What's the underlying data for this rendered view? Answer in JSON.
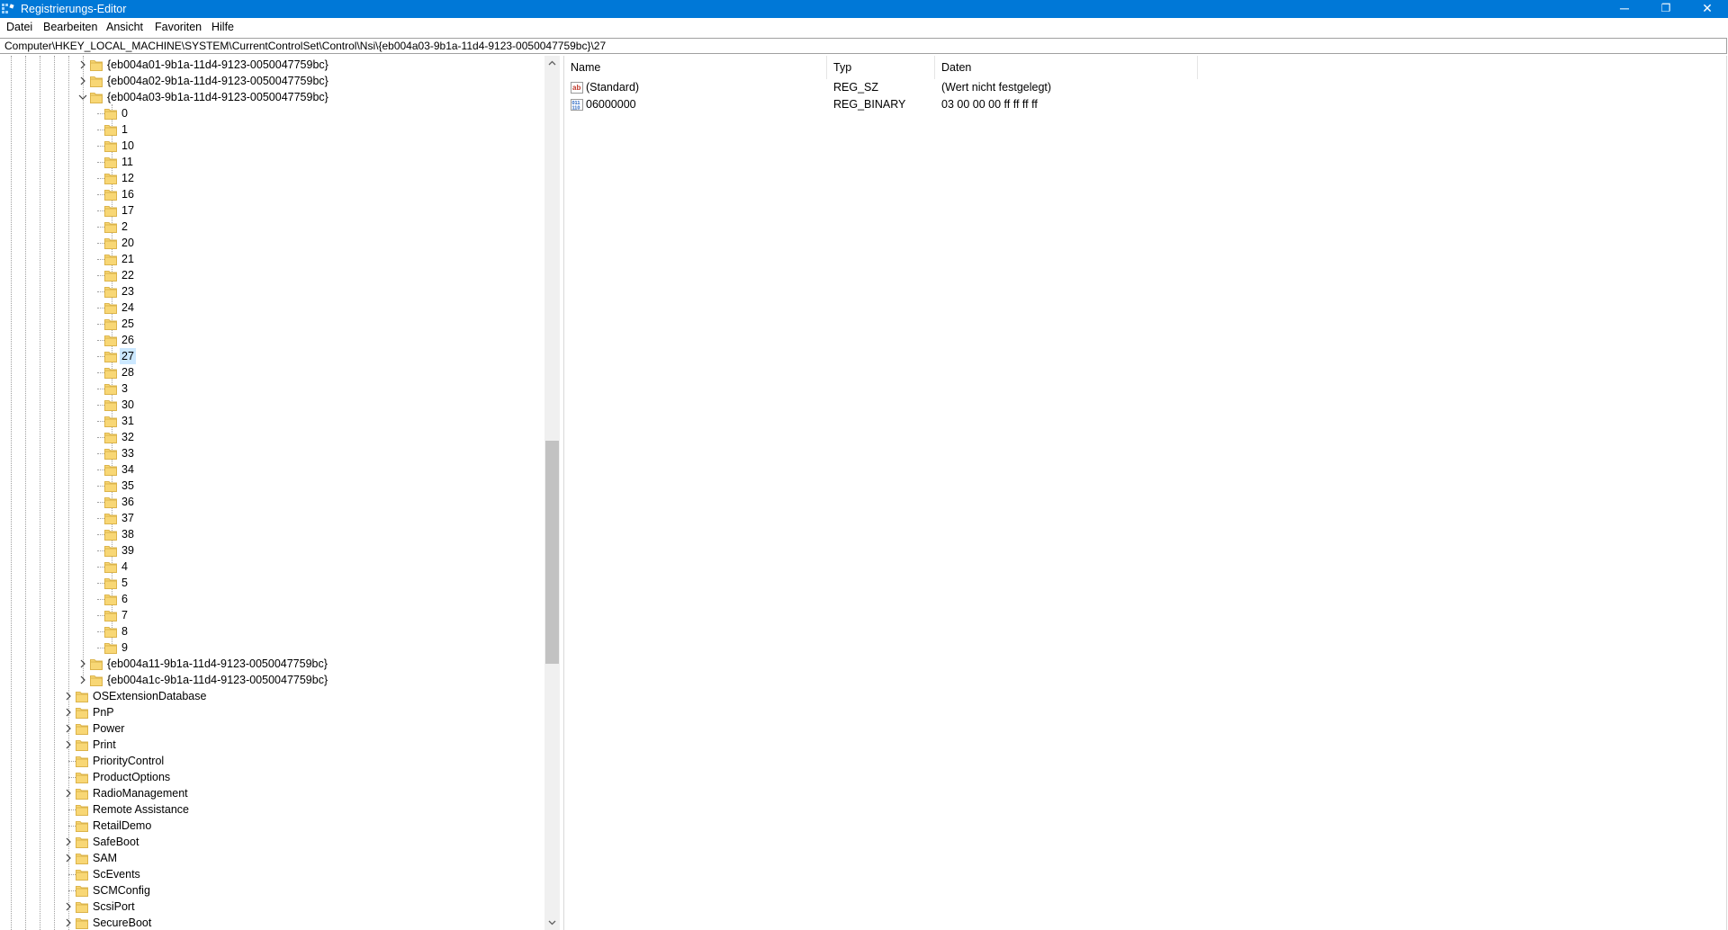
{
  "window": {
    "title": "Registrierungs-Editor",
    "controls": {
      "minimize": "─",
      "restore": "❐",
      "close": "✕"
    }
  },
  "menu": [
    "Datei",
    "Bearbeiten",
    "Ansicht",
    "Favoriten",
    "Hilfe"
  ],
  "address": "Computer\\HKEY_LOCAL_MACHINE\\SYSTEM\\CurrentControlSet\\Control\\Nsi\\{eb004a03-9b1a-11d4-9123-0050047759bc}\\27",
  "tree": [
    {
      "label": "{eb004a01-9b1a-11d4-9123-0050047759bc}",
      "level": 2,
      "expander": "collapsed"
    },
    {
      "label": "{eb004a02-9b1a-11d4-9123-0050047759bc}",
      "level": 2,
      "expander": "collapsed"
    },
    {
      "label": "{eb004a03-9b1a-11d4-9123-0050047759bc}",
      "level": 2,
      "expander": "expanded"
    },
    {
      "label": "0",
      "level": 3,
      "expander": "none"
    },
    {
      "label": "1",
      "level": 3,
      "expander": "none"
    },
    {
      "label": "10",
      "level": 3,
      "expander": "none"
    },
    {
      "label": "11",
      "level": 3,
      "expander": "none"
    },
    {
      "label": "12",
      "level": 3,
      "expander": "none"
    },
    {
      "label": "16",
      "level": 3,
      "expander": "none"
    },
    {
      "label": "17",
      "level": 3,
      "expander": "none"
    },
    {
      "label": "2",
      "level": 3,
      "expander": "none"
    },
    {
      "label": "20",
      "level": 3,
      "expander": "none"
    },
    {
      "label": "21",
      "level": 3,
      "expander": "none"
    },
    {
      "label": "22",
      "level": 3,
      "expander": "none"
    },
    {
      "label": "23",
      "level": 3,
      "expander": "none"
    },
    {
      "label": "24",
      "level": 3,
      "expander": "none"
    },
    {
      "label": "25",
      "level": 3,
      "expander": "none"
    },
    {
      "label": "26",
      "level": 3,
      "expander": "none"
    },
    {
      "label": "27",
      "level": 3,
      "expander": "none",
      "selected": true
    },
    {
      "label": "28",
      "level": 3,
      "expander": "none"
    },
    {
      "label": "3",
      "level": 3,
      "expander": "none"
    },
    {
      "label": "30",
      "level": 3,
      "expander": "none"
    },
    {
      "label": "31",
      "level": 3,
      "expander": "none"
    },
    {
      "label": "32",
      "level": 3,
      "expander": "none"
    },
    {
      "label": "33",
      "level": 3,
      "expander": "none"
    },
    {
      "label": "34",
      "level": 3,
      "expander": "none"
    },
    {
      "label": "35",
      "level": 3,
      "expander": "none"
    },
    {
      "label": "36",
      "level": 3,
      "expander": "none"
    },
    {
      "label": "37",
      "level": 3,
      "expander": "none"
    },
    {
      "label": "38",
      "level": 3,
      "expander": "none"
    },
    {
      "label": "39",
      "level": 3,
      "expander": "none"
    },
    {
      "label": "4",
      "level": 3,
      "expander": "none"
    },
    {
      "label": "5",
      "level": 3,
      "expander": "none"
    },
    {
      "label": "6",
      "level": 3,
      "expander": "none"
    },
    {
      "label": "7",
      "level": 3,
      "expander": "none"
    },
    {
      "label": "8",
      "level": 3,
      "expander": "none"
    },
    {
      "label": "9",
      "level": 3,
      "expander": "none"
    },
    {
      "label": "{eb004a11-9b1a-11d4-9123-0050047759bc}",
      "level": 2,
      "expander": "collapsed"
    },
    {
      "label": "{eb004a1c-9b1a-11d4-9123-0050047759bc}",
      "level": 2,
      "expander": "collapsed"
    },
    {
      "label": "OSExtensionDatabase",
      "level": 1,
      "expander": "collapsed"
    },
    {
      "label": "PnP",
      "level": 1,
      "expander": "collapsed"
    },
    {
      "label": "Power",
      "level": 1,
      "expander": "collapsed"
    },
    {
      "label": "Print",
      "level": 1,
      "expander": "collapsed"
    },
    {
      "label": "PriorityControl",
      "level": 1,
      "expander": "none"
    },
    {
      "label": "ProductOptions",
      "level": 1,
      "expander": "none"
    },
    {
      "label": "RadioManagement",
      "level": 1,
      "expander": "collapsed"
    },
    {
      "label": "Remote Assistance",
      "level": 1,
      "expander": "none"
    },
    {
      "label": "RetailDemo",
      "level": 1,
      "expander": "none"
    },
    {
      "label": "SafeBoot",
      "level": 1,
      "expander": "collapsed"
    },
    {
      "label": "SAM",
      "level": 1,
      "expander": "collapsed"
    },
    {
      "label": "ScEvents",
      "level": 1,
      "expander": "none"
    },
    {
      "label": "SCMConfig",
      "level": 1,
      "expander": "none"
    },
    {
      "label": "ScsiPort",
      "level": 1,
      "expander": "collapsed"
    },
    {
      "label": "SecureBoot",
      "level": 1,
      "expander": "collapsed"
    }
  ],
  "list": {
    "columns": [
      "Name",
      "Typ",
      "Daten"
    ],
    "rows": [
      {
        "icon": "string-value-icon",
        "name": "(Standard)",
        "type": "REG_SZ",
        "data": "(Wert nicht festgelegt)"
      },
      {
        "icon": "binary-value-icon",
        "name": "06000000",
        "type": "REG_BINARY",
        "data": "03 00 00 00 ff ff ff ff"
      }
    ]
  },
  "colors": {
    "titlebar": "#0078d7",
    "selection": "#cce8ff",
    "folder": "#f8d775",
    "folder_edge": "#dcb44b"
  }
}
